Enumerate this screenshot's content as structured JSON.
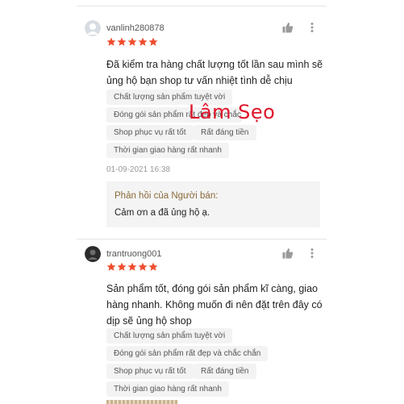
{
  "reviews": [
    {
      "username": "vanlinh280878",
      "rating": 5,
      "text_lines": [
        "Đã kiểm tra hàng chất lượng tốt lần sau mình sẽ",
        "ủng hộ bạn shop tư vấn nhiệt tình dễ chịu"
      ],
      "tags": [
        "Chất lượng sản phẩm tuyệt vời",
        "Đóng gói sản phẩm rất đẹp và chắc chắn",
        "Shop phục vụ rất tốt",
        "Rất đáng tiền",
        "Thời gian giao hàng rất nhanh"
      ],
      "date": "01-09-2021 16:38",
      "seller_reply": {
        "title": "Phản hồi của Người bán:",
        "text": "Cảm ơn a đã ủng hộ ạ."
      }
    },
    {
      "username": "trantruong001",
      "rating": 5,
      "text_lines": [
        "Sản phẩm tốt, đóng gói sản phẩm kĩ càng, giao",
        "hàng nhanh. Không muốn đi nên đặt trên đây có",
        "dịp sẽ ủng hộ shop"
      ],
      "tags": [
        "Chất lượng sản phẩm tuyệt vời",
        "Đóng gói sản phẩm rất đẹp và chắc chắn",
        "Shop phục vụ rất tốt",
        "Rất đáng tiền",
        "Thời gian giao hàng rất nhanh"
      ]
    }
  ],
  "watermark": "Lâm Sẹo",
  "icons": {
    "like": "thumbs-up-icon",
    "more": "more-vertical-icon",
    "star": "star-icon"
  },
  "colors": {
    "star": "#ee4d2d",
    "watermark": "#e0142a",
    "reply_title": "#8a6a3a"
  }
}
